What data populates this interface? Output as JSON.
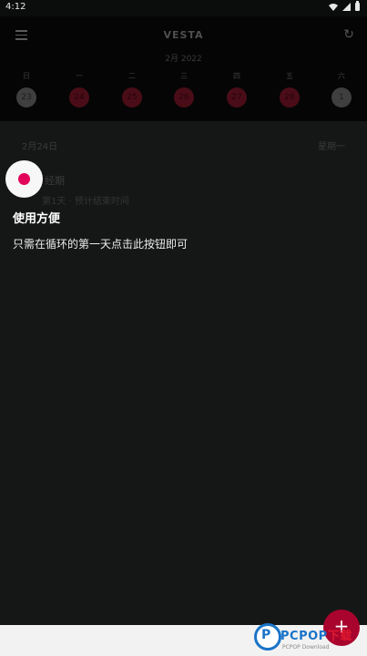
{
  "status": {
    "time": "4:12"
  },
  "appbar": {
    "title": "VESTA",
    "subtitle": "2月 2022"
  },
  "week": {
    "labels": [
      "日",
      "一",
      "二",
      "三",
      "四",
      "五",
      "六"
    ],
    "days": [
      "23",
      "24",
      "25",
      "26",
      "27",
      "28",
      "1"
    ]
  },
  "list": {
    "date_left": "2月24日",
    "date_right": "星期一",
    "item_title": "经期",
    "item_sub": "第1天 · 预计结束时间"
  },
  "tip": {
    "title": "使用方便",
    "body": "只需在循环的第一天点击此按钮即可"
  },
  "fab": {
    "label": "+"
  },
  "watermark": {
    "brand": "PCPOP",
    "suffix": "下载",
    "small": "PCPOP Download"
  },
  "colors": {
    "accent": "#e2045a",
    "background": "#151716"
  }
}
